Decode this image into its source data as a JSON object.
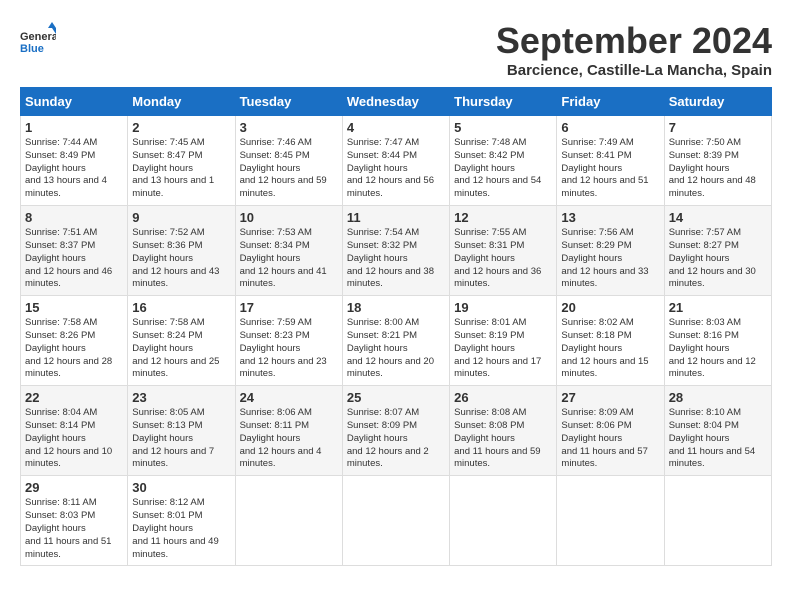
{
  "header": {
    "logo_general": "General",
    "logo_blue": "Blue",
    "month_title": "September 2024",
    "location": "Barcience, Castille-La Mancha, Spain"
  },
  "days_of_week": [
    "Sunday",
    "Monday",
    "Tuesday",
    "Wednesday",
    "Thursday",
    "Friday",
    "Saturday"
  ],
  "weeks": [
    [
      {
        "day": "1",
        "sunrise": "7:44 AM",
        "sunset": "8:49 PM",
        "daylight": "13 hours and 4 minutes."
      },
      {
        "day": "2",
        "sunrise": "7:45 AM",
        "sunset": "8:47 PM",
        "daylight": "13 hours and 1 minute."
      },
      {
        "day": "3",
        "sunrise": "7:46 AM",
        "sunset": "8:45 PM",
        "daylight": "12 hours and 59 minutes."
      },
      {
        "day": "4",
        "sunrise": "7:47 AM",
        "sunset": "8:44 PM",
        "daylight": "12 hours and 56 minutes."
      },
      {
        "day": "5",
        "sunrise": "7:48 AM",
        "sunset": "8:42 PM",
        "daylight": "12 hours and 54 minutes."
      },
      {
        "day": "6",
        "sunrise": "7:49 AM",
        "sunset": "8:41 PM",
        "daylight": "12 hours and 51 minutes."
      },
      {
        "day": "7",
        "sunrise": "7:50 AM",
        "sunset": "8:39 PM",
        "daylight": "12 hours and 48 minutes."
      }
    ],
    [
      {
        "day": "8",
        "sunrise": "7:51 AM",
        "sunset": "8:37 PM",
        "daylight": "12 hours and 46 minutes."
      },
      {
        "day": "9",
        "sunrise": "7:52 AM",
        "sunset": "8:36 PM",
        "daylight": "12 hours and 43 minutes."
      },
      {
        "day": "10",
        "sunrise": "7:53 AM",
        "sunset": "8:34 PM",
        "daylight": "12 hours and 41 minutes."
      },
      {
        "day": "11",
        "sunrise": "7:54 AM",
        "sunset": "8:32 PM",
        "daylight": "12 hours and 38 minutes."
      },
      {
        "day": "12",
        "sunrise": "7:55 AM",
        "sunset": "8:31 PM",
        "daylight": "12 hours and 36 minutes."
      },
      {
        "day": "13",
        "sunrise": "7:56 AM",
        "sunset": "8:29 PM",
        "daylight": "12 hours and 33 minutes."
      },
      {
        "day": "14",
        "sunrise": "7:57 AM",
        "sunset": "8:27 PM",
        "daylight": "12 hours and 30 minutes."
      }
    ],
    [
      {
        "day": "15",
        "sunrise": "7:58 AM",
        "sunset": "8:26 PM",
        "daylight": "12 hours and 28 minutes."
      },
      {
        "day": "16",
        "sunrise": "7:58 AM",
        "sunset": "8:24 PM",
        "daylight": "12 hours and 25 minutes."
      },
      {
        "day": "17",
        "sunrise": "7:59 AM",
        "sunset": "8:23 PM",
        "daylight": "12 hours and 23 minutes."
      },
      {
        "day": "18",
        "sunrise": "8:00 AM",
        "sunset": "8:21 PM",
        "daylight": "12 hours and 20 minutes."
      },
      {
        "day": "19",
        "sunrise": "8:01 AM",
        "sunset": "8:19 PM",
        "daylight": "12 hours and 17 minutes."
      },
      {
        "day": "20",
        "sunrise": "8:02 AM",
        "sunset": "8:18 PM",
        "daylight": "12 hours and 15 minutes."
      },
      {
        "day": "21",
        "sunrise": "8:03 AM",
        "sunset": "8:16 PM",
        "daylight": "12 hours and 12 minutes."
      }
    ],
    [
      {
        "day": "22",
        "sunrise": "8:04 AM",
        "sunset": "8:14 PM",
        "daylight": "12 hours and 10 minutes."
      },
      {
        "day": "23",
        "sunrise": "8:05 AM",
        "sunset": "8:13 PM",
        "daylight": "12 hours and 7 minutes."
      },
      {
        "day": "24",
        "sunrise": "8:06 AM",
        "sunset": "8:11 PM",
        "daylight": "12 hours and 4 minutes."
      },
      {
        "day": "25",
        "sunrise": "8:07 AM",
        "sunset": "8:09 PM",
        "daylight": "12 hours and 2 minutes."
      },
      {
        "day": "26",
        "sunrise": "8:08 AM",
        "sunset": "8:08 PM",
        "daylight": "11 hours and 59 minutes."
      },
      {
        "day": "27",
        "sunrise": "8:09 AM",
        "sunset": "8:06 PM",
        "daylight": "11 hours and 57 minutes."
      },
      {
        "day": "28",
        "sunrise": "8:10 AM",
        "sunset": "8:04 PM",
        "daylight": "11 hours and 54 minutes."
      }
    ],
    [
      {
        "day": "29",
        "sunrise": "8:11 AM",
        "sunset": "8:03 PM",
        "daylight": "11 hours and 51 minutes."
      },
      {
        "day": "30",
        "sunrise": "8:12 AM",
        "sunset": "8:01 PM",
        "daylight": "11 hours and 49 minutes."
      },
      null,
      null,
      null,
      null,
      null
    ]
  ]
}
